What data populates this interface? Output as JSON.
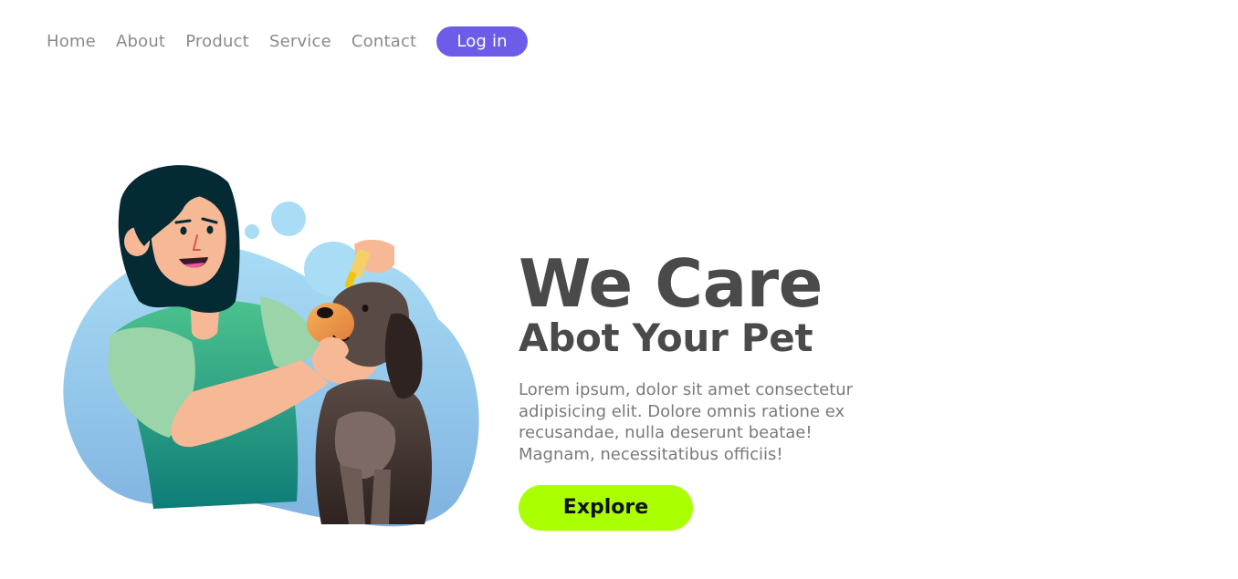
{
  "nav": {
    "items": [
      {
        "label": "Home"
      },
      {
        "label": "About"
      },
      {
        "label": "Product"
      },
      {
        "label": "Service"
      },
      {
        "label": "Contact"
      }
    ],
    "login_label": "Log in"
  },
  "hero": {
    "title": "We Care",
    "subtitle": "Abot Your Pet",
    "body": "Lorem ipsum, dolor sit amet consectetur adipisicing elit. Dolore omnis ratione ex recusandae, nulla deserunt beatae! Magnam, necessitatibus officiis!",
    "button_label": "Explore"
  },
  "colors": {
    "accent": "#6c5ce7",
    "cta": "#aaff00",
    "heading": "#4a4a4a",
    "body_text": "#7a7a7a",
    "nav_text": "#8a8a8a"
  },
  "illustration": {
    "icon": "woman-caring-for-dog-illustration"
  }
}
